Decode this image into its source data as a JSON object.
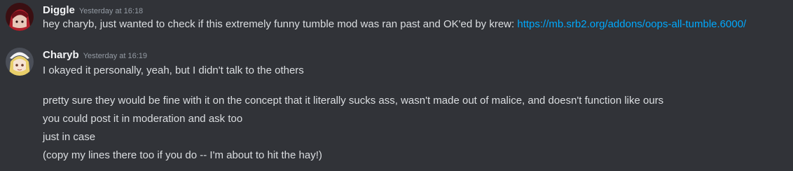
{
  "messages": [
    {
      "username": "Diggle",
      "timestamp": "Yesterday at 16:18",
      "lines": [
        "hey charyb, just wanted to check if this extremely funny tumble mod was ran past and OK'ed by krew:"
      ],
      "link": "https://mb.srb2.org/addons/oops-all-tumble.6000/"
    },
    {
      "username": "Charyb",
      "timestamp": "Yesterday at 16:19",
      "lines": [
        "I okayed it personally, yeah, but I didn't talk to the others",
        "pretty sure they would be fine with it on the concept that it literally sucks ass, wasn't made out of malice, and doesn't function like ours",
        "you could post it in moderation and ask too",
        "just in case",
        "(copy my lines there too if you do -- I'm about to hit the hay!)"
      ]
    }
  ],
  "colors": {
    "background": "#313338",
    "username": "#f2f3f5",
    "timestamp": "#949ba4",
    "text": "#dbdee1",
    "link": "#00a8fc"
  },
  "icons": {
    "diggle_avatar": "diggle-avatar",
    "charyb_avatar": "charyb-avatar"
  }
}
